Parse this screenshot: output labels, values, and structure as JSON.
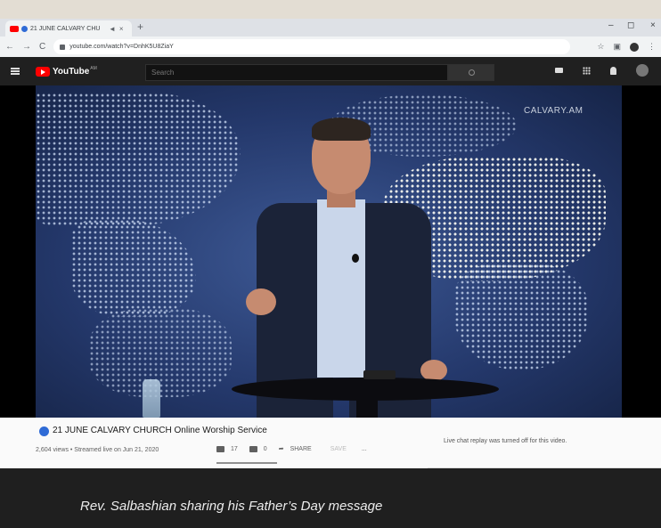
{
  "browser": {
    "tab_title": "21 JUNE CALVARY CHU",
    "tab_mute_icon": "speaker-icon",
    "tab_close": "×",
    "new_tab": "+",
    "url": "youtube.com/watch?v=DnhK5U8ZiaY",
    "window_minimize": "–",
    "window_maximize": "◻",
    "window_close": "×",
    "nav_back": "←",
    "nav_forward": "→",
    "nav_reload": "C",
    "bookmark_star": "☆"
  },
  "youtube": {
    "logo_text": "YouTube",
    "country_code": "AM",
    "search_placeholder": "Search"
  },
  "video": {
    "watermark": "CALVARY.AM"
  },
  "details": {
    "title": "21 JUNE CALVARY CHURCH Online Worship Service",
    "meta": "2,604 views • Streamed live on Jun 21, 2020",
    "likes": "17",
    "dislikes": "0",
    "share_label": "SHARE",
    "save_label": "SAVE",
    "more_label": "...",
    "chat_notice": "Live chat replay was turned off for this video."
  },
  "caption": "Rev. Salbashian sharing his Father’s Day message",
  "colors": {
    "brand_red": "#ff0000",
    "live_blue": "#2f6bd6",
    "dark_bg": "#1f1f1f"
  }
}
